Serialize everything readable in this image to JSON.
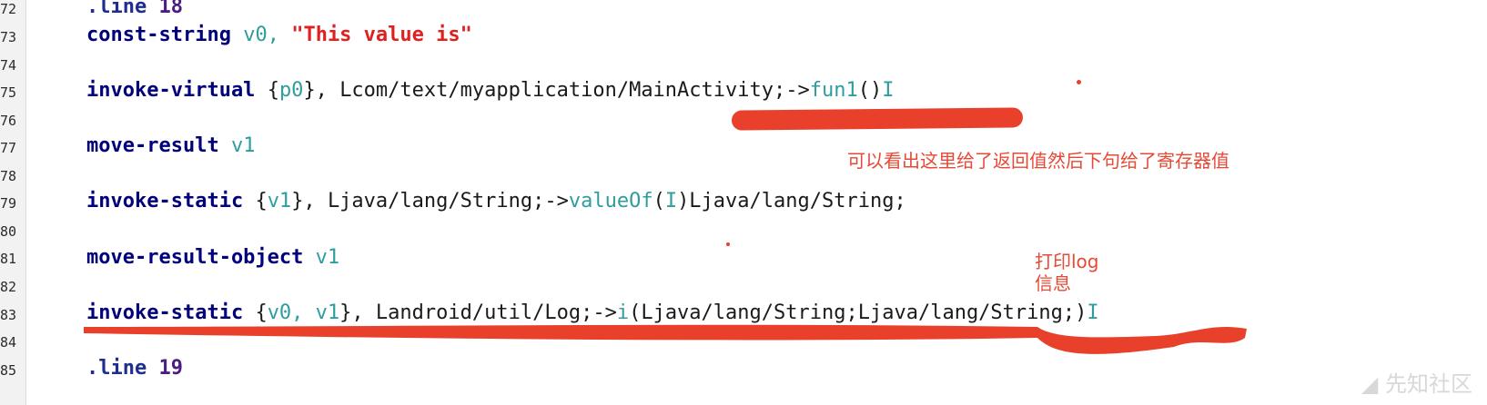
{
  "line_numbers": [
    "72",
    "73",
    "74",
    "75",
    "76",
    "77",
    "78",
    "79",
    "80",
    "81",
    "82",
    "83",
    "84",
    "85"
  ],
  "code": {
    "l72_dir": ".line",
    "l72_num": "18",
    "l73_kw": "const-string",
    "l73_reg": "v0,",
    "l73_str": "\"This value is\"",
    "l75_kw": "invoke-virtual",
    "l75_open": "{",
    "l75_reg": "p0",
    "l75_close": "},",
    "l75_ref": "Lcom/text/myapplication/MainActivity;->",
    "l75_meth": "fun1",
    "l75_paren": "()",
    "l75_ret": "I",
    "l77_kw": "move-result",
    "l77_reg": "v1",
    "l79_kw": "invoke-static",
    "l79_open": "{",
    "l79_reg": "v1",
    "l79_close": "},",
    "l79_ref": "Ljava/lang/String;->",
    "l79_meth": "valueOf",
    "l79_paren1": "(",
    "l79_arg": "I",
    "l79_paren2": ")Ljava/lang/String;",
    "l81_kw": "move-result-object",
    "l81_reg": "v1",
    "l83_kw": "invoke-static",
    "l83_open": "{",
    "l83_reg": "v0, v1",
    "l83_close": "},",
    "l83_ref": "Landroid/util/Log;->",
    "l83_meth": "i",
    "l83_args": "(Ljava/lang/String;Ljava/lang/String;)",
    "l83_ret": "I",
    "l85_dir": ".line",
    "l85_num": "19"
  },
  "annotations": {
    "note1": "可以看出这里给了返回值然后下句给了寄存器值",
    "note2_line1": "打印log",
    "note2_line2": "信息"
  },
  "watermark": "先知社区",
  "colors": {
    "annotation": "#e8402a",
    "register": "#2f9d9d",
    "string": "#e02020"
  }
}
